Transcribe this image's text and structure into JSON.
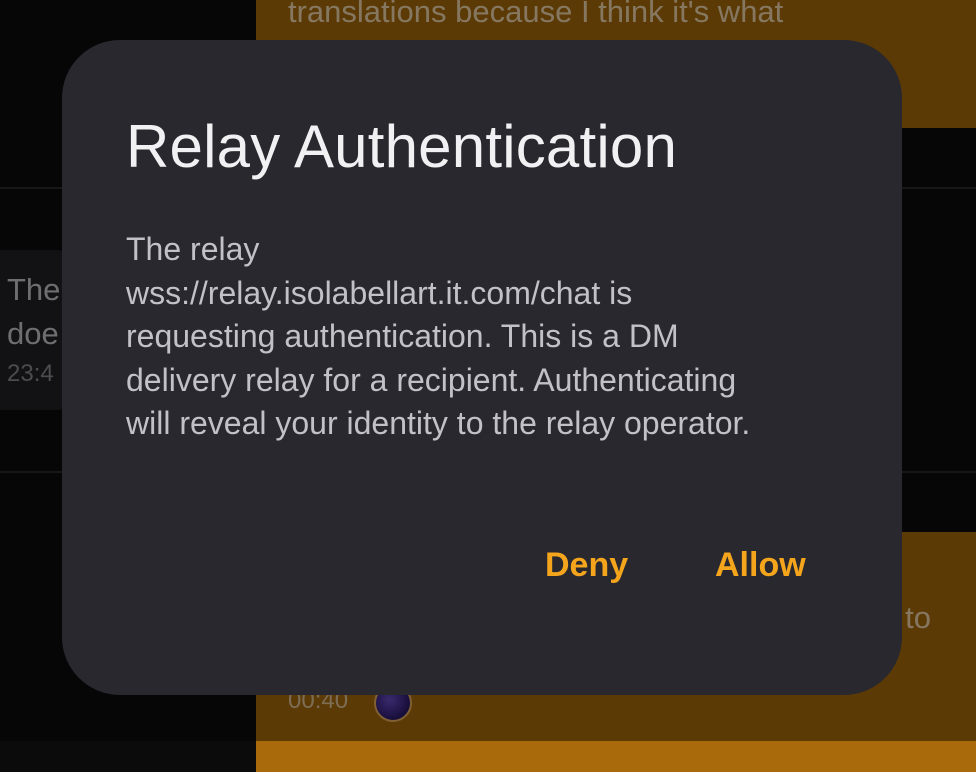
{
  "background": {
    "top_bubble_text": "translations because I think it's what",
    "left_bubble_line1": "The",
    "left_bubble_line2": "doe",
    "left_bubble_time": "23:4",
    "bottom_bubble_text": "to",
    "bottom_bubble_time": "00:40"
  },
  "dialog": {
    "title": "Relay Authentication",
    "body_lines": [
      "The relay",
      "wss://relay.isolabellart.it.com/chat is",
      "requesting authentication. This is a DM",
      "delivery relay for a recipient. Authenticating",
      "will reveal your identity to the relay operator."
    ],
    "deny_label": "Deny",
    "allow_label": "Allow"
  },
  "colors": {
    "accent": "#f4a51c",
    "dialog_bg": "#29282e",
    "outgoing_bubble": "#a86a0a"
  }
}
